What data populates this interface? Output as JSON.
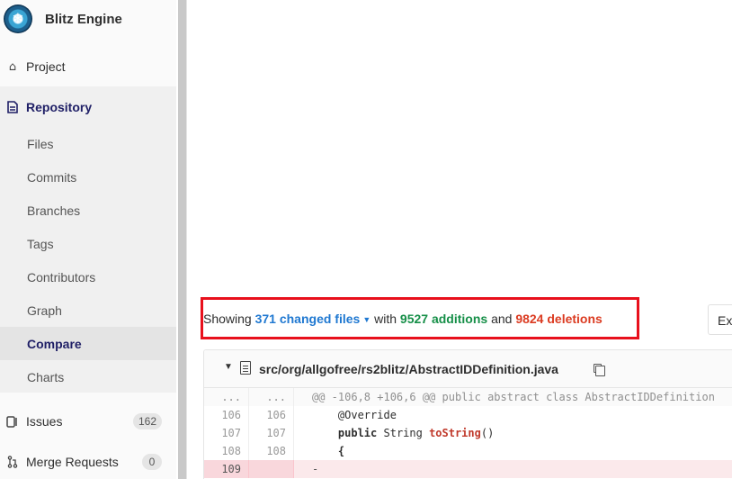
{
  "project": {
    "name": "Blitz Engine"
  },
  "sidebar": {
    "project_label": "Project",
    "repository_label": "Repository",
    "repository_items": [
      {
        "label": "Files",
        "active": false
      },
      {
        "label": "Commits",
        "active": false
      },
      {
        "label": "Branches",
        "active": false
      },
      {
        "label": "Tags",
        "active": false
      },
      {
        "label": "Contributors",
        "active": false
      },
      {
        "label": "Graph",
        "active": false
      },
      {
        "label": "Compare",
        "active": true
      },
      {
        "label": "Charts",
        "active": false
      }
    ],
    "issues": {
      "label": "Issues",
      "count": "162"
    },
    "merge_requests": {
      "label": "Merge Requests",
      "count": "0"
    }
  },
  "summary": {
    "prefix": "Showing",
    "changed_files": "371 changed files",
    "with": "with",
    "additions": "9527 additions",
    "and": "and",
    "deletions": "9824 deletions"
  },
  "toolbar": {
    "expand_label": "Ex"
  },
  "file": {
    "path": "src/org/allgofree/rs2blitz/AbstractIDDefinition.java",
    "lines": [
      {
        "type": "match",
        "old": "...",
        "new": "...",
        "code": "@@ -106,8 +106,6 @@ public abstract class AbstractIDDefinition"
      },
      {
        "type": "context",
        "old": "106",
        "new": "106",
        "indent": "    ",
        "kw": "",
        "text": "@Override",
        "fn": "",
        "tail": ""
      },
      {
        "type": "context",
        "old": "107",
        "new": "107",
        "indent": "    ",
        "kw": "public",
        "text": " String ",
        "fn": "toString",
        "tail": "()"
      },
      {
        "type": "context",
        "old": "108",
        "new": "108",
        "indent": "    ",
        "kw": "",
        "text": "{",
        "fn": "",
        "tail": ""
      },
      {
        "type": "del",
        "old": "109",
        "new": "",
        "indent": "",
        "kw": "",
        "text": "-",
        "fn": "",
        "tail": ""
      }
    ]
  },
  "colors": {
    "highlight_box": "#e8101c",
    "changed_files": "#1f78d1",
    "additions": "#168f48",
    "deletions": "#db3b21"
  },
  "icons": {
    "project": "home-icon",
    "repository": "document-icon",
    "issues": "issues-icon",
    "merge_requests": "merge-request-icon"
  }
}
